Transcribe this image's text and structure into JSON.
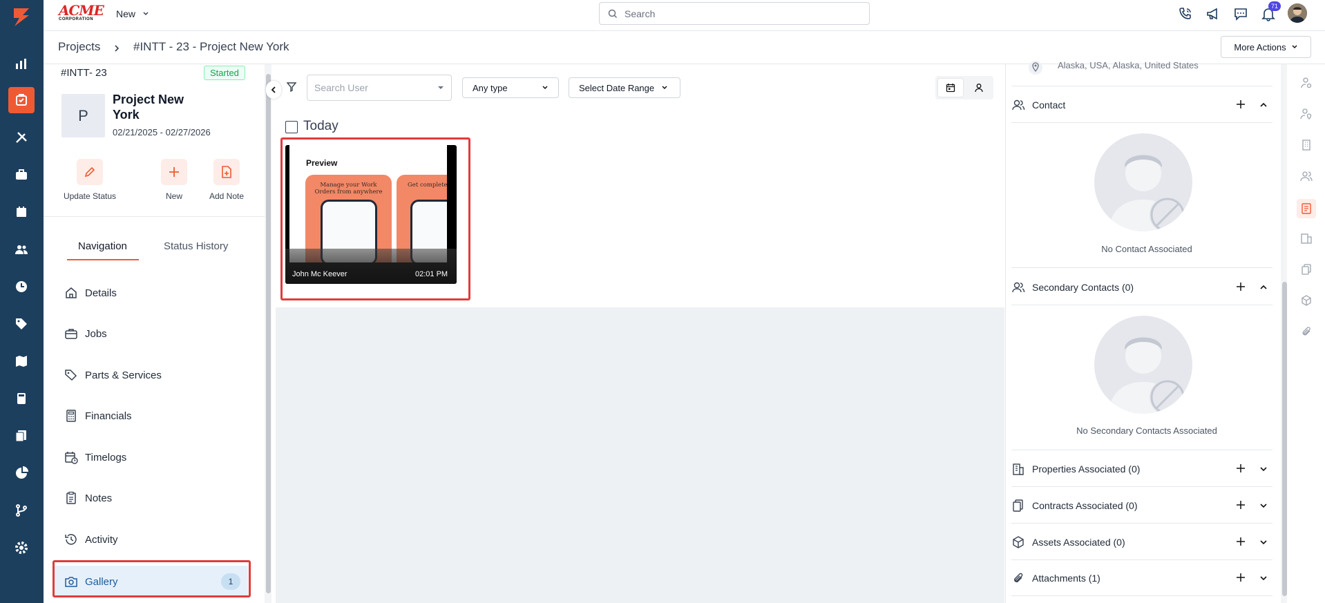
{
  "app": {
    "logo_text": "ACME",
    "logo_subtext": "CORPORATION",
    "new_label": "New",
    "search_placeholder": "Search",
    "notification_count": "71"
  },
  "breadcrumb": {
    "root": "Projects",
    "current": "#INTT - 23 - Project New York",
    "more_actions": "More Actions"
  },
  "project": {
    "code": "#INTT- 23",
    "status": "Started",
    "avatar_letter": "P",
    "name_line1": "Project New",
    "name_line2": "York",
    "dates": "02/21/2025 - 02/27/2026"
  },
  "quick_actions": [
    {
      "label": "Update Status"
    },
    {
      "label": "New"
    },
    {
      "label": "Add Note"
    }
  ],
  "tabs": {
    "navigation": "Navigation",
    "status_history": "Status History"
  },
  "nav": [
    {
      "label": "Details"
    },
    {
      "label": "Jobs"
    },
    {
      "label": "Parts & Services"
    },
    {
      "label": "Financials"
    },
    {
      "label": "Timelogs"
    },
    {
      "label": "Notes"
    },
    {
      "label": "Activity"
    },
    {
      "label": "Gallery",
      "badge": "1"
    }
  ],
  "filters": {
    "search_user_placeholder": "Search User",
    "type": "Any type",
    "date_range": "Select Date Range"
  },
  "gallery": {
    "group_label": "Today",
    "item": {
      "preview_title": "Preview",
      "card1_text": "Manage your Work Orders from anywhere",
      "card2_text": "Get complete view of your Work",
      "author": "John Mc Keever",
      "time": "02:01 PM"
    }
  },
  "right": {
    "address": "Alaska, USA, Alaska, United States",
    "contact_title": "Contact",
    "no_contact": "No Contact Associated",
    "secondary_title": "Secondary Contacts (0)",
    "no_secondary": "No Secondary Contacts Associated",
    "properties": "Properties Associated (0)",
    "contracts": "Contracts Associated (0)",
    "assets": "Assets Associated (0)",
    "attachments": "Attachments (1)"
  },
  "colors": {
    "rail": "#1d3f5e",
    "accent": "#ef5a35",
    "status_green": "#16a34a",
    "highlight_red": "#e03c3c",
    "selected_bg": "#e6f0fa"
  }
}
